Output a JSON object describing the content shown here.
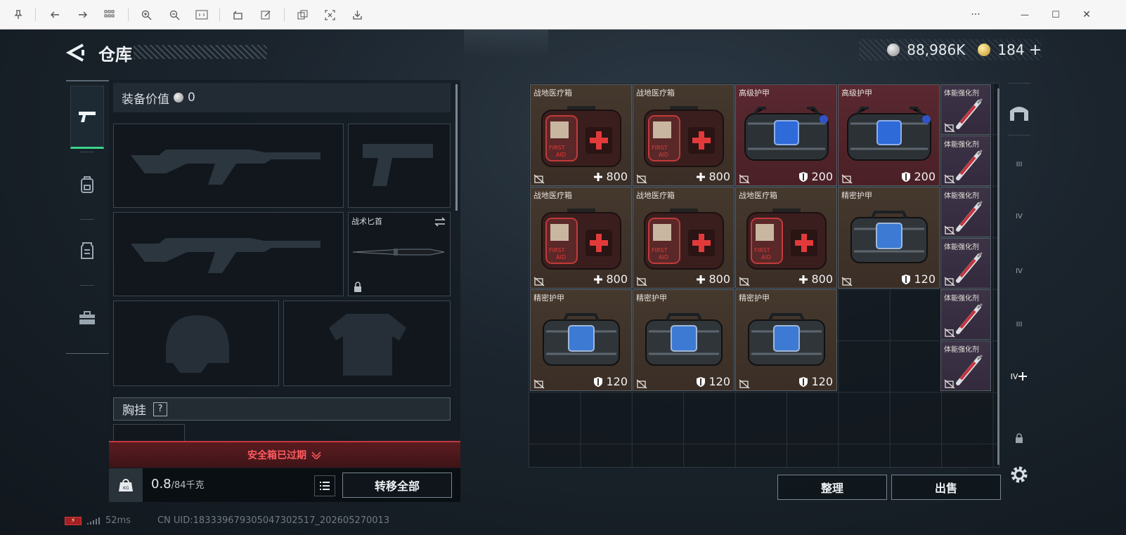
{
  "window": {
    "toolbar_icons": [
      "pin-icon",
      "back-icon",
      "forward-icon",
      "grid-icon",
      "zoom-in-icon",
      "zoom-out-icon",
      "fit-icon",
      "rotate-icon",
      "edit-icon",
      "copy-icon",
      "crop-icon",
      "save-icon"
    ],
    "more_label": "···",
    "minimize_label": "—",
    "maximize_label": "☐",
    "close_label": "✕"
  },
  "header": {
    "title": "仓库"
  },
  "currency": {
    "silver": "88,986K",
    "gold": "184",
    "plus": "+"
  },
  "equip": {
    "value_label": "装备价值",
    "value_amount": "0",
    "knife_label": "战术匕首",
    "chest_label": "胸挂",
    "chest_help": "?",
    "safebox_status": "安全箱已过期",
    "weight_value": "0.8",
    "weight_max": "/84千克",
    "transfer_all": "转移全部"
  },
  "stash": {
    "items": [
      {
        "name": "战地医疗箱",
        "value": "800",
        "kind": "medkit",
        "bg": "brown",
        "stat": "plus"
      },
      {
        "name": "战地医疗箱",
        "value": "800",
        "kind": "medkit",
        "bg": "brown",
        "stat": "plus"
      },
      {
        "name": "高级护甲",
        "value": "200",
        "kind": "armor-blue",
        "bg": "red",
        "stat": "shield"
      },
      {
        "name": "高级护甲",
        "value": "200",
        "kind": "armor-blue",
        "bg": "red",
        "stat": "shield"
      },
      {
        "name": "战地医疗箱",
        "value": "800",
        "kind": "medkit",
        "bg": "brown",
        "stat": "plus"
      },
      {
        "name": "战地医疗箱",
        "value": "800",
        "kind": "medkit",
        "bg": "brown",
        "stat": "plus"
      },
      {
        "name": "战地医疗箱",
        "value": "800",
        "kind": "medkit",
        "bg": "brown",
        "stat": "plus"
      },
      {
        "name": "精密护甲",
        "value": "120",
        "kind": "armor-grey",
        "bg": "brown",
        "stat": "shield"
      },
      {
        "name": "精密护甲",
        "value": "120",
        "kind": "armor-grey",
        "bg": "brown",
        "stat": "shield"
      },
      {
        "name": "精密护甲",
        "value": "120",
        "kind": "armor-grey",
        "bg": "brown",
        "stat": "shield"
      },
      {
        "name": "精密护甲",
        "value": "120",
        "kind": "armor-grey",
        "bg": "brown",
        "stat": "shield"
      }
    ],
    "injectors": [
      "体能强化剂",
      "体能强化剂",
      "体能强化剂",
      "体能强化剂",
      "体能强化剂",
      "体能强化剂"
    ],
    "sort_label": "整理",
    "sell_label": "出售"
  },
  "rail": {
    "labels": [
      "III",
      "IV",
      "IV",
      "III",
      "IV"
    ]
  },
  "status": {
    "ping": "52ms",
    "uid": "CN UID:183339679305047302517_202605270013"
  },
  "colors": {
    "accent_green": "#3ed38b",
    "expired_red": "#ff5a5f"
  }
}
